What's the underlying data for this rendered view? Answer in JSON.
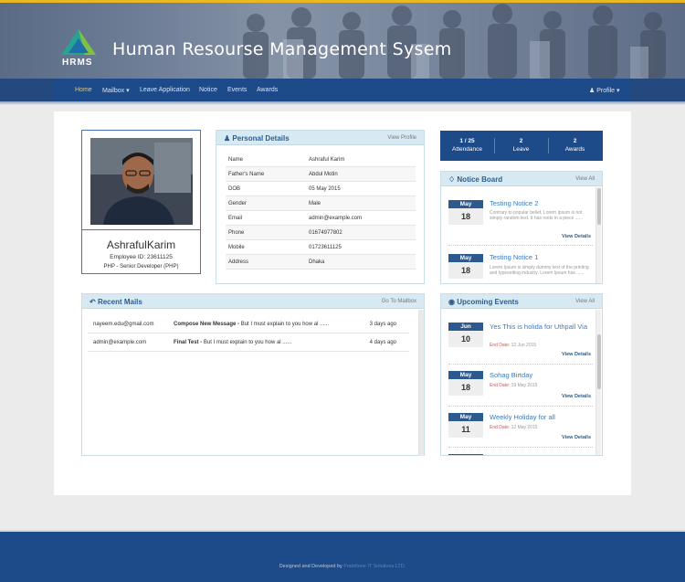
{
  "header": {
    "logo_text": "HRMS",
    "site_title": "Human Resourse Management Sysem"
  },
  "nav": {
    "home": "Home",
    "mailbox": "Mailbox ▾",
    "leave_application": "Leave Application",
    "notice": "Notice",
    "events": "Events",
    "awards": "Awards",
    "profile": "Profile ▾"
  },
  "profile": {
    "name": "AshrafulKarim",
    "employee_id": "Employee ID: 23611125",
    "role": "PHP - Senior Developer (PHP)"
  },
  "personal_details": {
    "title": "Personal Details",
    "link": "View Profile",
    "rows": [
      {
        "label": "Name",
        "value": "Ashraful Karim"
      },
      {
        "label": "Father's Name",
        "value": "Abdul Motin"
      },
      {
        "label": "DOB",
        "value": "05 May 2015"
      },
      {
        "label": "Gender",
        "value": "Male"
      },
      {
        "label": "Email",
        "value": "admin@example.com"
      },
      {
        "label": "Phone",
        "value": "01674977802"
      },
      {
        "label": "Mobile",
        "value": "01723611125"
      },
      {
        "label": "Address",
        "value": "Dhaka"
      }
    ]
  },
  "stats": [
    {
      "value": "1 / 25",
      "label": "Attendance"
    },
    {
      "value": "2",
      "label": "Leave"
    },
    {
      "value": "2",
      "label": "Awards"
    }
  ],
  "notice_board": {
    "title": "Notice Board",
    "link": "View All",
    "items": [
      {
        "month": "May",
        "day": "18",
        "title": "Testing Notice 2",
        "text": "Contrary to popular belief, Lorem Ipsum is not simply random text. It has roots in a piece ......",
        "details": "View Details"
      },
      {
        "month": "May",
        "day": "18",
        "title": "Testing Notice 1",
        "text": "Lorem Ipsum is simply dummy text of the printing and typesetting industry. Lorem Ipsum has ......",
        "details": "View Details"
      }
    ]
  },
  "recent_mails": {
    "title": "Recent Mails",
    "link": "Go To Mailbox",
    "items": [
      {
        "from": "nayeem.edu@gmail.com",
        "subject": "Compose New Message -",
        "preview": "But I must explain to you how al ......",
        "time": "3 days ago"
      },
      {
        "from": "admin@example.com",
        "subject": "Final Test -",
        "preview": "But I must explain to you how al ......",
        "time": "4 days ago"
      }
    ]
  },
  "upcoming_events": {
    "title": "Upcoming Events",
    "link": "View All",
    "end_label": "End Date:",
    "items": [
      {
        "month": "Jun",
        "day": "10",
        "title": "Yes This is holida for Uthpall Via",
        "end_date": "12 Jun 2015",
        "details": "View Details"
      },
      {
        "month": "May",
        "day": "18",
        "title": "Sohag Birtday",
        "end_date": "19 May 2015",
        "details": "View Details"
      },
      {
        "month": "May",
        "day": "11",
        "title": "Weekly Holiday for all",
        "end_date": "12 May 2015",
        "details": "View Details"
      }
    ]
  },
  "footer": {
    "prefix": "Designed and Developed by",
    "company": "Fratellone IT Solutions LTD."
  },
  "colors": {
    "navy": "#1d4a88",
    "accent_yellow": "#e8b923",
    "link_blue": "#3b7bbd",
    "panel_head": "#d7eaf3"
  },
  "icons": {
    "personal_details": "user-icon",
    "notice_board": "bell-icon",
    "recent_mails": "reply-icon",
    "upcoming_events": "binoculars-icon",
    "profile": "user-icon"
  }
}
